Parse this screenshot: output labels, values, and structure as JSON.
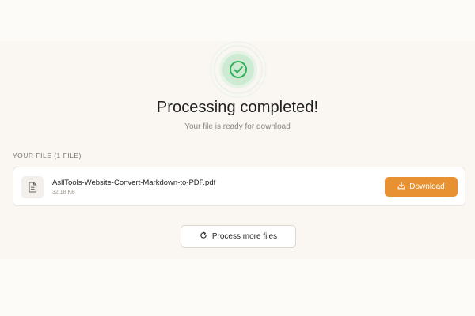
{
  "status": {
    "title": "Processing completed!",
    "subtitle": "Your file is ready for download",
    "icon": "check-circle-icon",
    "accent_color": "#2fae55"
  },
  "files_section": {
    "label": "YOUR FILE (1 FILE)",
    "files": [
      {
        "name": "AsllTools-Website-Convert-Markdown-to-PDF.pdf",
        "size": "32.18 KB",
        "icon": "document-icon",
        "download_label": "Download",
        "download_icon": "download-icon"
      }
    ]
  },
  "actions": {
    "process_more_label": "Process more files",
    "process_more_icon": "refresh-icon"
  },
  "colors": {
    "download_button": "#e89132",
    "background": "#faf6f2"
  }
}
